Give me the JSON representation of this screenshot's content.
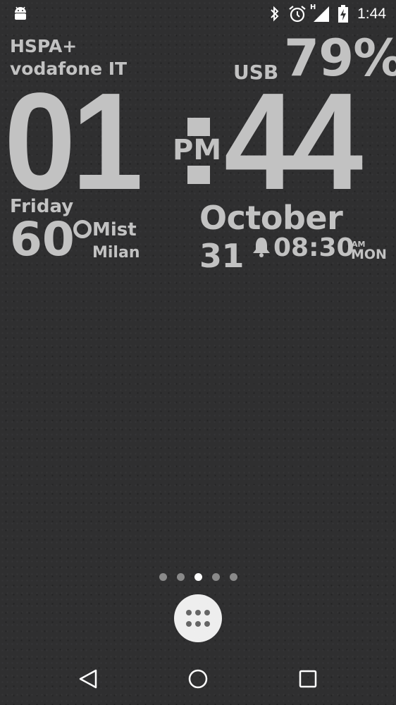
{
  "status_bar": {
    "time": "1:44",
    "network_type_badge": "H",
    "icons": [
      "android-icon",
      "bluetooth-icon",
      "alarm-clock-icon",
      "signal-icon",
      "battery-charging-icon"
    ]
  },
  "widget": {
    "network_type": "HSPA+",
    "carrier": "vodafone IT",
    "charge_source": "USB",
    "battery_percent": "79%",
    "hour": "01",
    "minute": "44",
    "ampm": "PM",
    "weekday": "Friday",
    "temperature": "60",
    "condition": "Mist",
    "city": "Milan",
    "date": "October 31",
    "alarm_time": "08:30",
    "alarm_ampm": "AM",
    "alarm_day": "MON"
  },
  "home": {
    "page_count": 5,
    "active_page": 3
  },
  "colors": {
    "background": "#2f2f30",
    "widget_text": "#c2c2c2",
    "status_icons": "#ffffff"
  },
  "nav": {
    "icons": [
      "back-icon",
      "home-icon",
      "recents-icon"
    ]
  }
}
